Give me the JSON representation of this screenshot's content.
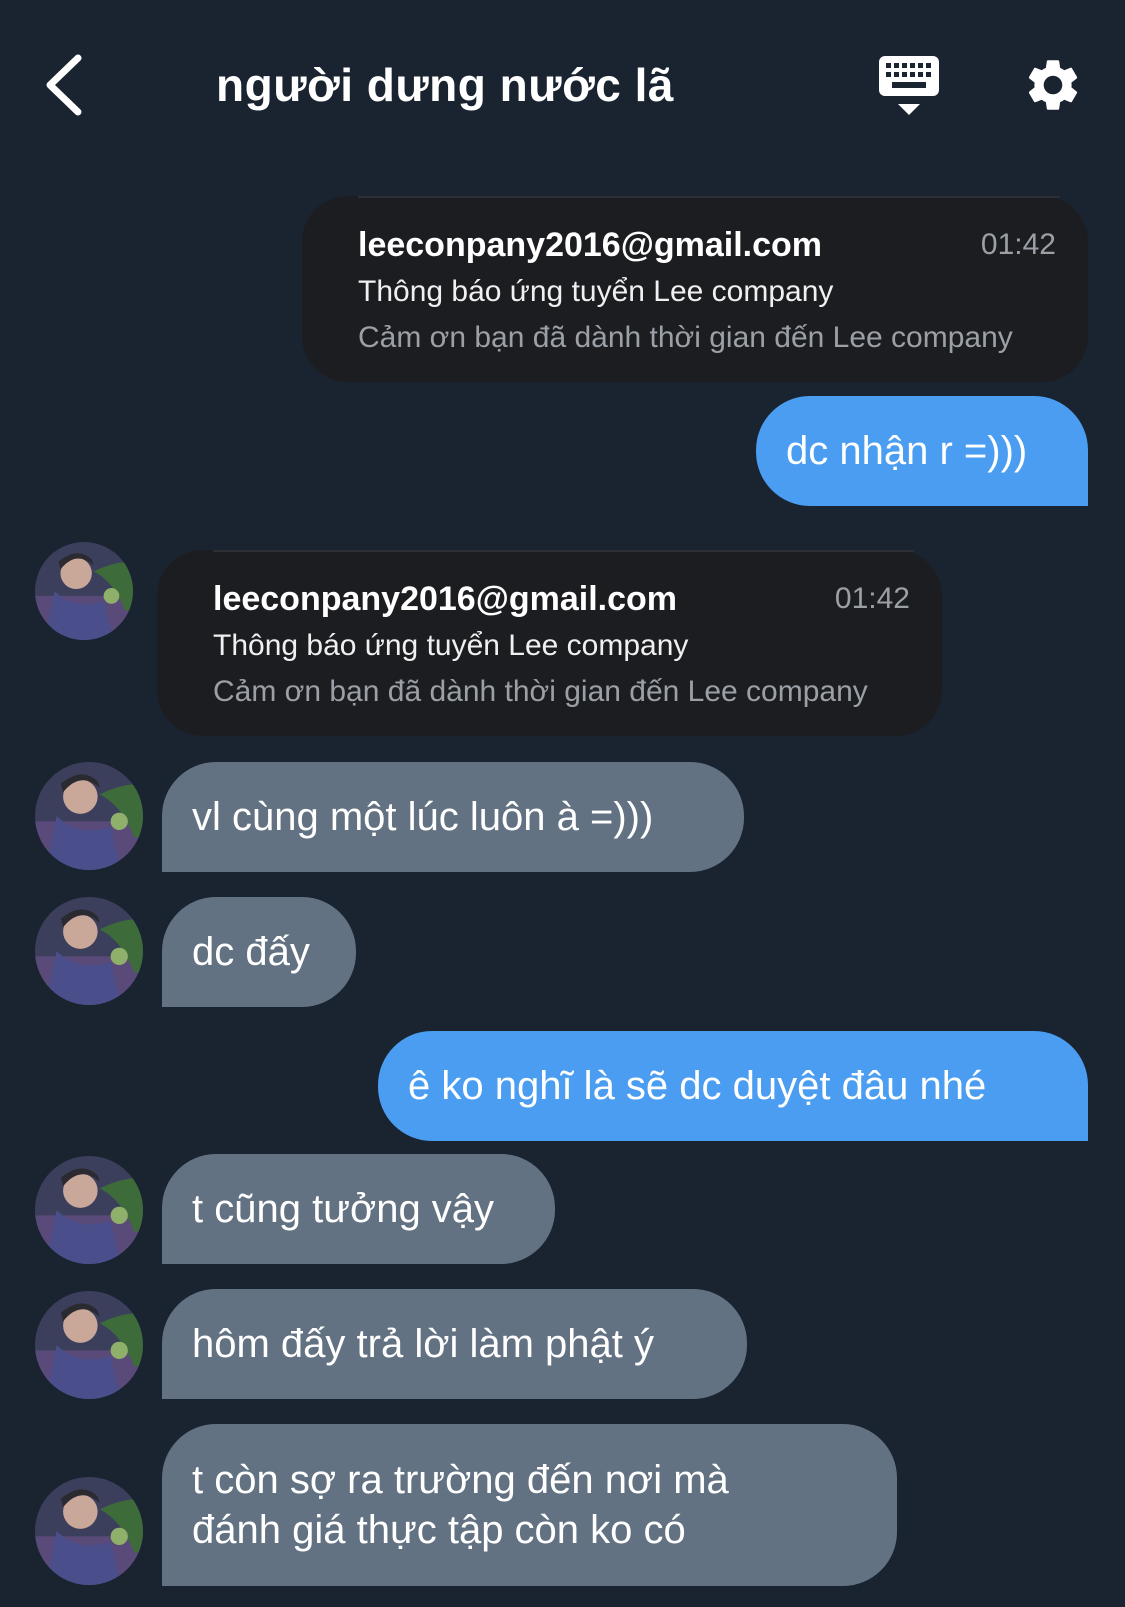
{
  "header": {
    "title": "người dưng nước lã",
    "back_icon": "chevron-left-icon",
    "keyboard_icon": "keyboard-icon",
    "settings_icon": "gear-icon"
  },
  "colors": {
    "background": "#1a2330",
    "sent_bubble": "#4a9df0",
    "received_bubble": "#637282",
    "email_card": "#1c1d21"
  },
  "messages": [
    {
      "type": "email",
      "side": "sent",
      "from": "leeconpany2016@gmail.com",
      "time": "01:42",
      "subject": "Thông báo ứng tuyển Lee company",
      "preview": "Cảm ơn bạn đã dành thời gian đến Lee company"
    },
    {
      "type": "text",
      "side": "sent",
      "text": "dc nhận r =)))"
    },
    {
      "type": "email",
      "side": "received",
      "from": "leeconpany2016@gmail.com",
      "time": "01:42",
      "subject": "Thông báo ứng tuyển Lee company",
      "preview": "Cảm ơn bạn đã dành thời gian đến Lee company"
    },
    {
      "type": "text",
      "side": "received",
      "text": "vl cùng một lúc luôn à =)))"
    },
    {
      "type": "text",
      "side": "received",
      "text": "dc đấy"
    },
    {
      "type": "text",
      "side": "sent",
      "text": "ê ko nghĩ là sẽ dc duyệt đâu nhé"
    },
    {
      "type": "text",
      "side": "received",
      "text": "t cũng tưởng vậy"
    },
    {
      "type": "text",
      "side": "received",
      "text": "hôm đấy trả lời làm phật ý"
    },
    {
      "type": "text",
      "side": "received",
      "text_line1": "t còn sợ ra trường đến nơi mà",
      "text_line2": "đánh giá thực tập còn ko có"
    }
  ]
}
